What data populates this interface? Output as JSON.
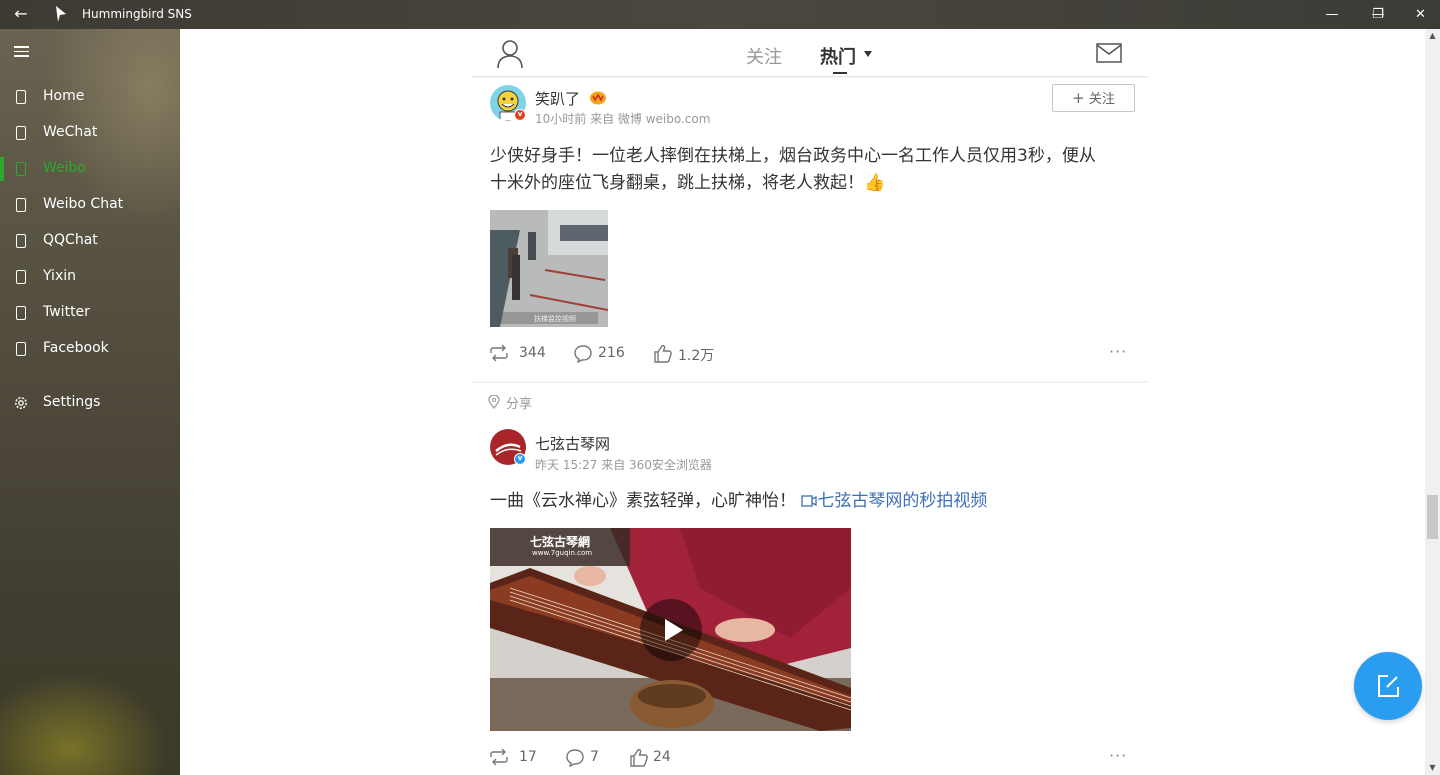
{
  "window": {
    "title": "Hummingbird SNS",
    "back_glyph": "←",
    "minimize_glyph": "—",
    "restore_glyph": "❐",
    "close_glyph": "✕"
  },
  "sidebar": {
    "items": [
      {
        "label": "Home",
        "icon": "page-icon"
      },
      {
        "label": "WeChat",
        "icon": "page-icon"
      },
      {
        "label": "Weibo",
        "icon": "page-icon",
        "active": true
      },
      {
        "label": "Weibo Chat",
        "icon": "page-icon"
      },
      {
        "label": "QQChat",
        "icon": "page-icon"
      },
      {
        "label": "Yixin",
        "icon": "page-icon"
      },
      {
        "label": "Twitter",
        "icon": "page-icon"
      },
      {
        "label": "Facebook",
        "icon": "page-icon"
      }
    ],
    "settings_label": "Settings",
    "active_color": "#2ea82e"
  },
  "header": {
    "tab_follow": "关注",
    "tab_hot": "热门"
  },
  "posts": [
    {
      "author": "笑趴了",
      "meta": "10小时前 来自 微博 weibo.com",
      "follow_label": "关注",
      "text_line1": "少侠好身手！一位老人摔倒在扶梯上，烟台政务中心一名工作人员仅用3秒，便从",
      "text_line2": "十米外的座位飞身翻桌，跳上扶梯，将老人救起！👍",
      "image_caption": "扶梯监控视频",
      "reposts": "344",
      "comments": "216",
      "likes": "1.2万",
      "more": "···"
    },
    {
      "share_label": "分享",
      "author": "七弦古琴网",
      "meta": "昨天 15:27 来自 360安全浏览器",
      "text": "一曲《云水禅心》素弦轻弹，心旷神怡！",
      "video_link": "七弦古琴网的秒拍视频",
      "video_logo": "七弦古琴網",
      "video_url_text": "www.7guqin.com",
      "reposts": "17",
      "comments": "7",
      "likes": "24",
      "more": "···"
    }
  ],
  "colors": {
    "link": "#3d6fb6",
    "fab": "#2b9df0"
  }
}
